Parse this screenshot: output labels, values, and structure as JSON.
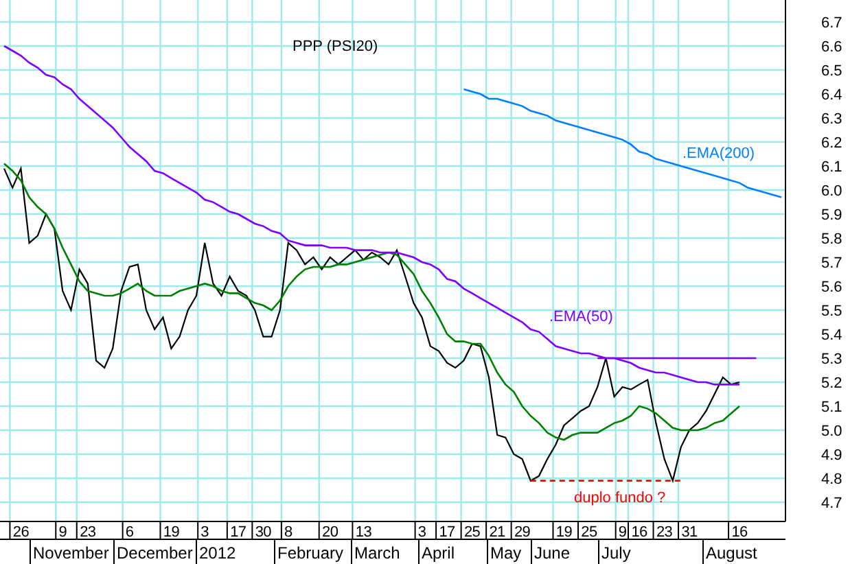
{
  "chart": {
    "chart_data": {
      "type": "line",
      "title": "PPP (PSI20)",
      "ylim": [
        4.7,
        6.7
      ],
      "categories": [
        null,
        null,
        "26",
        null,
        null,
        null,
        null,
        "9",
        null,
        null,
        "23",
        null,
        null,
        null,
        null,
        "6",
        null,
        null,
        null,
        null,
        "19",
        null,
        null,
        null,
        "3",
        null,
        null,
        null,
        "17",
        null,
        null,
        "30",
        null,
        null,
        "8",
        null,
        null,
        null,
        null,
        "20",
        null,
        null,
        null,
        "13",
        null,
        null,
        null,
        null,
        null,
        null,
        "3",
        null,
        null,
        "17",
        null,
        null,
        "25",
        null,
        null,
        "21",
        null,
        null,
        "29",
        null,
        null,
        null,
        null,
        "19",
        null,
        null,
        "25",
        null,
        null,
        null,
        "9",
        null,
        "16",
        null,
        null,
        "23",
        null,
        null,
        "31",
        null,
        null,
        null,
        null,
        null,
        "16",
        null,
        null,
        null,
        null,
        null
      ],
      "series": [
        {
          "color": "#000000",
          "values": [
            6.09,
            6.01,
            6.09,
            5.78,
            5.81,
            5.9,
            5.84,
            5.58,
            5.5,
            5.67,
            5.61,
            5.29,
            5.26,
            5.34,
            5.58,
            5.68,
            5.69,
            5.5,
            5.42,
            5.47,
            5.34,
            5.39,
            5.5,
            5.56,
            5.78,
            5.61,
            5.56,
            5.64,
            5.58,
            5.56,
            5.5,
            5.39,
            5.39,
            5.5,
            5.78,
            5.75,
            5.69,
            5.72,
            5.67,
            5.72,
            5.69,
            5.72,
            5.75,
            5.71,
            5.74,
            5.72,
            5.69,
            5.75,
            5.64,
            5.53,
            5.47,
            5.35,
            5.33,
            5.28,
            5.26,
            5.29,
            5.36,
            5.35,
            5.22,
            4.98,
            4.97,
            4.9,
            4.88,
            4.79,
            4.81,
            4.88,
            4.94,
            5.02,
            5.05,
            5.08,
            5.1,
            5.18,
            5.3,
            5.14,
            5.18,
            5.17,
            5.19,
            5.21,
            5.03,
            4.88,
            4.79,
            4.93,
            5.0,
            5.03,
            5.08,
            5.15,
            5.22,
            5.19,
            5.2,
            null,
            null,
            null,
            null,
            null
          ]
        },
        {
          "color": "#008000",
          "values": [
            6.11,
            6.08,
            6.04,
            5.97,
            5.93,
            5.9,
            5.84,
            5.76,
            5.69,
            5.62,
            5.58,
            5.57,
            5.56,
            5.56,
            5.57,
            5.59,
            5.61,
            5.58,
            5.56,
            5.56,
            5.56,
            5.58,
            5.59,
            5.6,
            5.61,
            5.6,
            5.58,
            5.57,
            5.57,
            5.55,
            5.53,
            5.52,
            5.5,
            5.54,
            5.6,
            5.64,
            5.67,
            5.68,
            5.68,
            5.68,
            5.69,
            5.69,
            5.7,
            5.71,
            5.72,
            5.73,
            5.74,
            5.73,
            5.69,
            5.65,
            5.58,
            5.53,
            5.47,
            5.4,
            5.37,
            5.37,
            5.36,
            5.36,
            5.31,
            5.24,
            5.19,
            5.16,
            5.1,
            5.06,
            5.03,
            4.99,
            4.97,
            4.96,
            4.98,
            4.99,
            4.99,
            4.99,
            5.01,
            5.03,
            5.04,
            5.06,
            5.1,
            5.09,
            5.07,
            5.04,
            5.01,
            5.0,
            5.0,
            5.0,
            5.01,
            5.03,
            5.04,
            5.07,
            5.1,
            null,
            null,
            null,
            null,
            null
          ]
        },
        {
          "name": ".EMA(50)",
          "color": "#8000ff",
          "values": [
            6.6,
            6.58,
            6.56,
            6.53,
            6.51,
            6.48,
            6.47,
            6.44,
            6.42,
            6.38,
            6.35,
            6.32,
            6.29,
            6.26,
            6.22,
            6.18,
            6.15,
            6.12,
            6.08,
            6.07,
            6.05,
            6.03,
            6.01,
            5.99,
            5.96,
            5.95,
            5.93,
            5.91,
            5.9,
            5.88,
            5.86,
            5.85,
            5.83,
            5.82,
            5.79,
            5.78,
            5.77,
            5.77,
            5.77,
            5.76,
            5.76,
            5.76,
            5.75,
            5.75,
            5.75,
            5.74,
            5.74,
            5.74,
            5.73,
            5.72,
            5.7,
            5.69,
            5.67,
            5.63,
            5.62,
            5.59,
            5.57,
            5.55,
            5.53,
            5.51,
            5.49,
            5.47,
            5.45,
            5.42,
            5.41,
            5.38,
            5.35,
            5.34,
            5.33,
            5.32,
            5.32,
            5.31,
            5.3,
            5.3,
            5.29,
            5.28,
            5.26,
            5.25,
            5.24,
            5.24,
            5.23,
            5.22,
            5.21,
            5.2,
            5.2,
            5.19,
            5.19,
            5.19,
            5.19,
            null,
            null,
            null,
            null,
            null
          ]
        },
        {
          "name": ".EMA(200)",
          "color": "#0080ff",
          "values": [
            null,
            null,
            null,
            null,
            null,
            null,
            null,
            null,
            null,
            null,
            null,
            null,
            null,
            null,
            null,
            null,
            null,
            null,
            null,
            null,
            null,
            null,
            null,
            null,
            null,
            null,
            null,
            null,
            null,
            null,
            null,
            null,
            null,
            null,
            null,
            null,
            null,
            null,
            null,
            null,
            null,
            null,
            null,
            null,
            null,
            null,
            null,
            null,
            null,
            null,
            null,
            null,
            null,
            null,
            null,
            6.42,
            6.41,
            6.4,
            6.38,
            6.38,
            6.37,
            6.36,
            6.35,
            6.33,
            6.32,
            6.31,
            6.29,
            6.28,
            6.27,
            6.26,
            6.25,
            6.24,
            6.23,
            6.22,
            6.21,
            6.19,
            6.16,
            6.15,
            6.13,
            6.12,
            6.11,
            6.1,
            6.09,
            6.08,
            6.07,
            6.06,
            6.05,
            6.04,
            6.03,
            6.01,
            6.0,
            5.99,
            5.98,
            5.97
          ]
        },
        {
          "color": "#8000ff",
          "values": [
            null,
            null,
            null,
            null,
            null,
            null,
            null,
            null,
            null,
            null,
            null,
            null,
            null,
            null,
            null,
            null,
            null,
            null,
            null,
            null,
            null,
            null,
            null,
            null,
            null,
            null,
            null,
            null,
            null,
            null,
            null,
            null,
            null,
            null,
            null,
            null,
            null,
            null,
            null,
            null,
            null,
            null,
            null,
            null,
            null,
            null,
            null,
            null,
            null,
            null,
            null,
            null,
            null,
            null,
            null,
            null,
            null,
            null,
            null,
            null,
            null,
            null,
            null,
            null,
            null,
            null,
            null,
            null,
            null,
            null,
            null,
            5.3,
            5.3,
            5.3,
            5.3,
            5.3,
            5.3,
            5.3,
            5.3,
            5.3,
            5.3,
            5.3,
            5.3,
            5.3,
            5.3,
            5.3,
            5.3,
            5.3,
            5.3,
            5.3,
            5.3,
            null,
            null,
            null
          ]
        },
        {
          "color": "#ff0000",
          "line_style": "dashed",
          "values": [
            null,
            null,
            null,
            null,
            null,
            null,
            null,
            null,
            null,
            null,
            null,
            null,
            null,
            null,
            null,
            null,
            null,
            null,
            null,
            null,
            null,
            null,
            null,
            null,
            null,
            null,
            null,
            null,
            null,
            null,
            null,
            null,
            null,
            null,
            null,
            null,
            null,
            null,
            null,
            null,
            null,
            null,
            null,
            null,
            null,
            null,
            null,
            null,
            null,
            null,
            null,
            null,
            null,
            null,
            null,
            null,
            null,
            null,
            null,
            null,
            null,
            null,
            null,
            4.79,
            4.79,
            4.79,
            4.79,
            4.79,
            4.79,
            4.79,
            4.79,
            4.79,
            4.79,
            4.79,
            4.79,
            4.79,
            4.79,
            4.79,
            4.79,
            4.79,
            4.79,
            4.79,
            null,
            null,
            null,
            null,
            null,
            null,
            null,
            null,
            null,
            null,
            null,
            null
          ]
        }
      ],
      "yticks": [
        4.7,
        4.8,
        4.9,
        {
          "value": 5,
          "label": "5.0"
        },
        5.1,
        5.2,
        5.3,
        5.4,
        5.5,
        5.6,
        5.7,
        5.8,
        5.9,
        {
          "value": 6,
          "label": "6.0"
        },
        6.1,
        6.2,
        6.3,
        6.4,
        6.5,
        6.6,
        6.7
      ],
      "grid": true,
      "annotations": [
        "duplo fundo ?"
      ]
    },
    "month_axis": [
      "November",
      "December",
      "2012",
      "February",
      "March",
      "April",
      "May",
      "June",
      "July",
      "August"
    ]
  }
}
